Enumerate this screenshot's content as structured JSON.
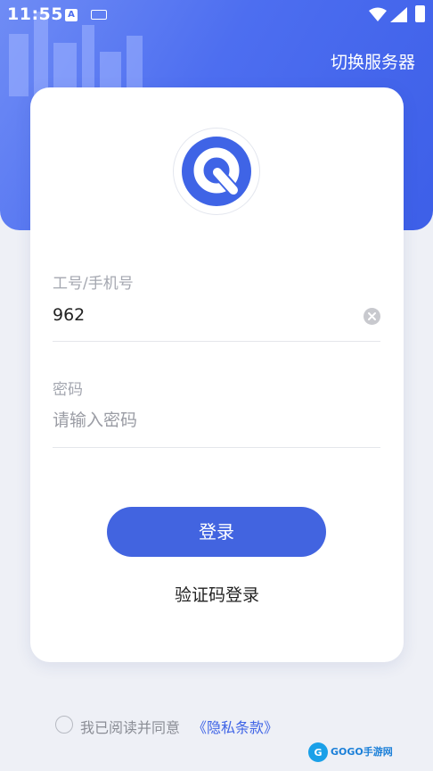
{
  "status_bar": {
    "time": "11:55",
    "input_badge": "A"
  },
  "header": {
    "switch_server": "切换服务器"
  },
  "form": {
    "account_label": "工号/手机号",
    "account_value": "962",
    "password_label": "密码",
    "password_placeholder": "请输入密码"
  },
  "actions": {
    "login_label": "登录",
    "sms_login_label": "验证码登录"
  },
  "agreement": {
    "text": "我已阅读并同意",
    "policy_link": "《隐私条款》"
  },
  "watermark": {
    "text": "GOGO手游网"
  },
  "icons": {
    "logo": "q-logo-icon",
    "clear": "clear-icon",
    "wifi": "wifi-icon",
    "signal": "signal-icon",
    "battery": "battery-icon",
    "keyboard": "keyboard-icon"
  },
  "colors": {
    "primary": "#4264e0",
    "hero": "#4d6ef0",
    "background": "#eef0f6"
  }
}
